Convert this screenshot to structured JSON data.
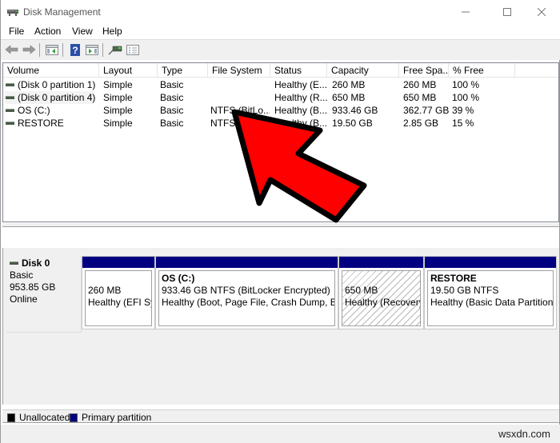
{
  "window": {
    "title": "Disk Management",
    "controls": {
      "minimize": "—",
      "maximize": "☐",
      "close": "✕"
    }
  },
  "menu": [
    "File",
    "Action",
    "View",
    "Help"
  ],
  "toolbar": {
    "buttons": [
      "back-icon",
      "forward-icon",
      "show-hide-console-tree-icon",
      "help-icon",
      "show-hide-action-pane-icon",
      "connect-icon",
      "properties-icon"
    ]
  },
  "volume_list": {
    "columns": [
      "Volume",
      "Layout",
      "Type",
      "File System",
      "Status",
      "Capacity",
      "Free Spa...",
      "% Free",
      ""
    ],
    "rows": [
      {
        "volume": "(Disk 0 partition 1)",
        "layout": "Simple",
        "type": "Basic",
        "fs": "",
        "status": "Healthy (E...",
        "capacity": "260 MB",
        "free": "260 MB",
        "pct": "100 %"
      },
      {
        "volume": "(Disk 0 partition 4)",
        "layout": "Simple",
        "type": "Basic",
        "fs": "",
        "status": "Healthy (R...",
        "capacity": "650 MB",
        "free": "650 MB",
        "pct": "100 %"
      },
      {
        "volume": "OS (C:)",
        "layout": "Simple",
        "type": "Basic",
        "fs": "NTFS (BitLo...",
        "status": "Healthy (B...",
        "capacity": "933.46 GB",
        "free": "362.77 GB",
        "pct": "39 %"
      },
      {
        "volume": "RESTORE",
        "layout": "Simple",
        "type": "Basic",
        "fs": "NTFS",
        "status": "Healthy (B...",
        "capacity": "19.50 GB",
        "free": "2.85 GB",
        "pct": "15 %"
      }
    ]
  },
  "disk": {
    "name": "Disk 0",
    "type": "Basic",
    "size": "953.85 GB",
    "state": "Online",
    "partitions": [
      {
        "name": "",
        "line1": "260 MB",
        "line2": "Healthy (EFI Sys",
        "hatched": false
      },
      {
        "name": "OS  (C:)",
        "line1": "933.46 GB NTFS (BitLocker Encrypted)",
        "line2": "Healthy (Boot, Page File, Crash Dump, Basic",
        "hatched": false
      },
      {
        "name": "",
        "line1": "650 MB",
        "line2": "Healthy (Recovery",
        "hatched": true
      },
      {
        "name": "RESTORE",
        "line1": "19.50 GB NTFS",
        "line2": "Healthy (Basic Data Partition)",
        "hatched": false
      }
    ]
  },
  "legend": [
    {
      "label": "Unallocated",
      "color": "#000000"
    },
    {
      "label": "Primary partition",
      "color": "#000080"
    }
  ],
  "annotation": {
    "type": "red-arrow",
    "color": "#ff0000",
    "outline": "#000000",
    "points_to": "File System column"
  },
  "watermark": "wsxdn.com"
}
